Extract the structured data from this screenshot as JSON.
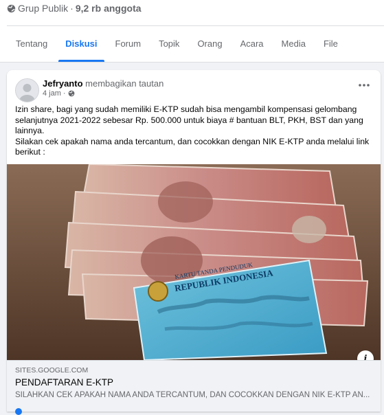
{
  "group": {
    "privacy_label": "Grup Publik",
    "separator": "·",
    "member_count": "9,2 rb anggota"
  },
  "tabs": [
    {
      "label": "Tentang",
      "active": false
    },
    {
      "label": "Diskusi",
      "active": true
    },
    {
      "label": "Forum",
      "active": false
    },
    {
      "label": "Topik",
      "active": false
    },
    {
      "label": "Orang",
      "active": false
    },
    {
      "label": "Acara",
      "active": false
    },
    {
      "label": "Media",
      "active": false
    },
    {
      "label": "File",
      "active": false
    }
  ],
  "post": {
    "author": "Jefryanto",
    "action": "membagikan tautan",
    "time": "4 jam",
    "time_separator": "·",
    "text_paragraph_1": "Izin share, bagi yang sudah memiliki E-KTP sudah bisa mengambil  kompensasi gelombang selanjutnya 2021-2022 sebesar Rp. 500.000 untuk biaya # bantuan BLT, PKH, BST dan yang lainnya.",
    "text_paragraph_2": "Silakan cek apakah nama anda tercantum, dan cocokkan dengan NIK E-KTP anda melalui link berikut :",
    "link": {
      "domain": "SITES.GOOGLE.COM",
      "title": "PENDAFTARAN E-KTP",
      "description": "SILAHKAN CEK APAKAH NAMA ANDA TERCANTUM, DAN COCOKKAN DENGAN NIK E-KTP AN..."
    },
    "image": {
      "card_title_1": "KARTU TANDA PENDUDUK",
      "card_title_2": "REPUBLIK INDONESIA"
    }
  },
  "icons": {
    "globe": "globe-icon",
    "more": "more-horizontal-icon",
    "info": "info-icon",
    "clock": "globe-small-icon"
  },
  "colors": {
    "accent": "#1877f2",
    "secondary_text": "#65676b",
    "page_bg": "#f0f2f5"
  }
}
